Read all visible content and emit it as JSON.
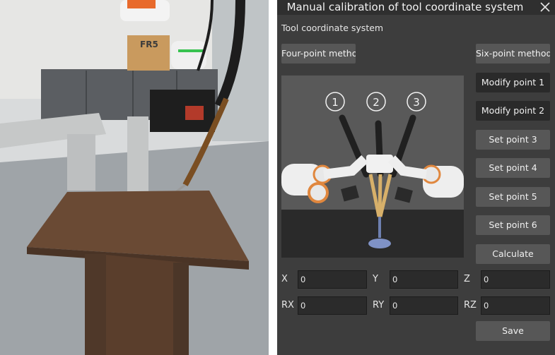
{
  "window": {
    "title": "Manual calibration of tool coordinate system"
  },
  "section": {
    "label": "Tool coordinate system"
  },
  "methods": {
    "four_point": "Four-point method",
    "six_point": "Six-point method"
  },
  "point_buttons": [
    {
      "label": "Modify point 1"
    },
    {
      "label": "Modify point 2"
    },
    {
      "label": "Set point 3"
    },
    {
      "label": "Set point 4"
    },
    {
      "label": "Set point 5"
    },
    {
      "label": "Set point 6"
    }
  ],
  "calculate_label": "Calculate",
  "save_label": "Save",
  "diagram": {
    "markers": [
      "①",
      "②",
      "③"
    ]
  },
  "photo": {
    "robot_label": "FR5"
  },
  "coordinates": [
    {
      "label": "X",
      "value": "0"
    },
    {
      "label": "Y",
      "value": "0"
    },
    {
      "label": "Z",
      "value": "0"
    },
    {
      "label": "RX",
      "value": "0"
    },
    {
      "label": "RY",
      "value": "0"
    },
    {
      "label": "RZ",
      "value": "0"
    }
  ],
  "colors": {
    "panel_bg": "#3d3d3d",
    "button_bg": "#575757",
    "active_button_bg": "#2a2a2a",
    "field_bg": "#2b2b2b"
  }
}
